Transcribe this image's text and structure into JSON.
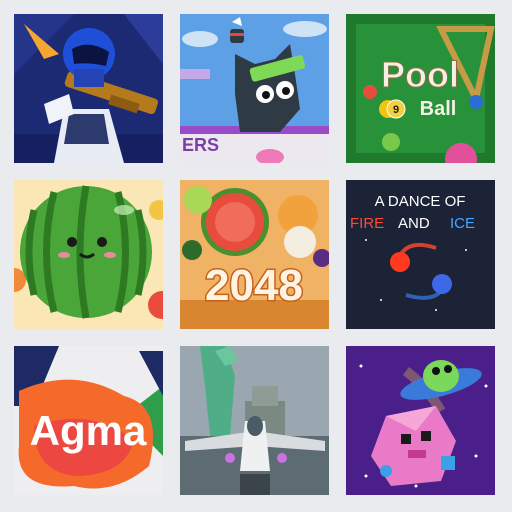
{
  "games": [
    {
      "id": "shooter",
      "text": ""
    },
    {
      "id": "ninja",
      "text": "ERS"
    },
    {
      "id": "pool",
      "title": "Pool",
      "subtitle": "Ball",
      "ball9": "9"
    },
    {
      "id": "watermelon",
      "text": ""
    },
    {
      "id": "2048",
      "text": "2048"
    },
    {
      "id": "dance",
      "line1": "A DANCE OF",
      "line2a": "FIRE",
      "line2b": "AND",
      "line2c": "ICE"
    },
    {
      "id": "agma",
      "text": "Agma"
    },
    {
      "id": "plane",
      "text": ""
    },
    {
      "id": "ufo",
      "text": ""
    }
  ]
}
